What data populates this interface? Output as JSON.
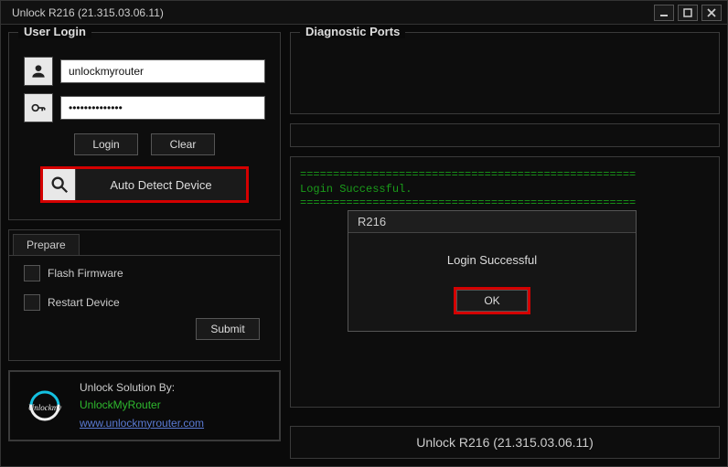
{
  "window": {
    "title": "Unlock R216 (21.315.03.06.11)"
  },
  "login": {
    "group_title": "User Login",
    "username": "unlockmyrouter",
    "password": "••••••••••••••",
    "login_btn": "Login",
    "clear_btn": "Clear",
    "auto_detect_btn": "Auto Detect Device"
  },
  "prepare": {
    "tab": "Prepare",
    "flash_label": "Flash Firmware",
    "restart_label": "Restart Device",
    "submit_btn": "Submit"
  },
  "footer": {
    "by": "Unlock Solution By:",
    "brand": "UnlockMyRouter",
    "url": "www.unlockmyrouter.com"
  },
  "diag": {
    "group_title": "Diagnostic Ports"
  },
  "log": {
    "separator": "===================================================",
    "msg": "Login Successful."
  },
  "dialog": {
    "title": "R216",
    "body": "Login Successful",
    "ok": "OK"
  },
  "status": {
    "footer": "Unlock R216 (21.315.03.06.11)"
  }
}
